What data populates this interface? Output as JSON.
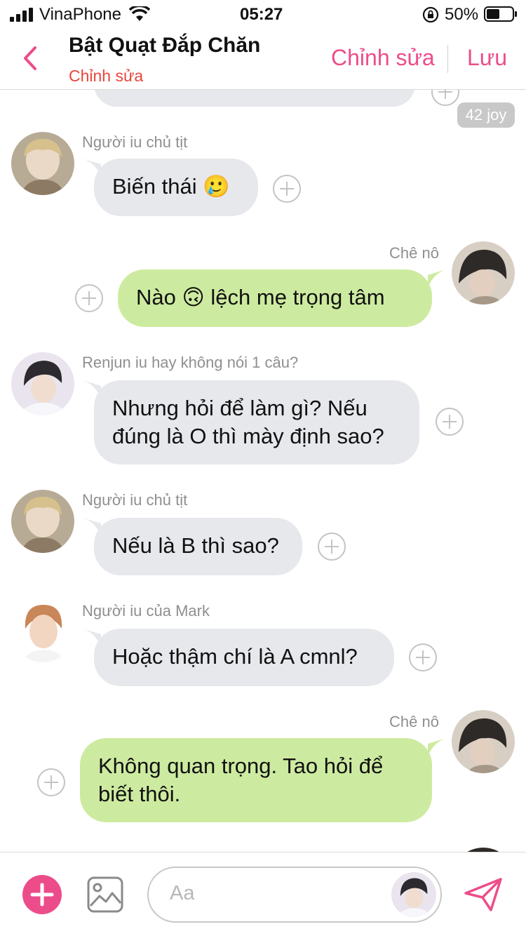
{
  "status_bar": {
    "carrier": "VinaPhone",
    "time": "05:27",
    "battery": "50%"
  },
  "header": {
    "title": "Bật Quạt Đắp Chăn",
    "subtitle": "Chỉnh sửa",
    "edit_label": "Chỉnh sửa",
    "save_label": "Lưu"
  },
  "messages": [
    {
      "badge": "42 joy"
    },
    {
      "direction": "in",
      "sender": "Người iu chủ tịt",
      "text": "Biến thái 🥲"
    },
    {
      "direction": "out",
      "sender": "Chê nô",
      "text": "Nào 🙃 lệch mẹ trọng tâm"
    },
    {
      "direction": "in",
      "sender": "Renjun iu hay không nói 1 câu?",
      "lines": [
        "Nhưng hỏi để làm gì? Nếu",
        "đúng là O thì mày định sao?"
      ]
    },
    {
      "direction": "in",
      "sender": "Người iu chủ tịt",
      "text": "Nếu là B thì sao?"
    },
    {
      "direction": "in",
      "sender": "Người iu của Mark",
      "text": "Hoặc thậm chí là A cmnl?"
    },
    {
      "direction": "out",
      "sender": "Chê nô",
      "lines": [
        "Không quan trọng. Tao hỏi để",
        "biết thôi."
      ]
    }
  ],
  "composer": {
    "placeholder": "Aa"
  },
  "colors": {
    "accent": "#ec4d8a",
    "subtitle": "#e8463b",
    "incoming_bubble": "#e6e8ec",
    "outgoing_bubble": "#cdeba0"
  },
  "icons": [
    "back-chevron-icon",
    "plus-circle-icon",
    "add-icon",
    "image-icon",
    "send-icon",
    "signal-icon",
    "wifi-icon",
    "lock-rotation-icon",
    "battery-icon"
  ]
}
